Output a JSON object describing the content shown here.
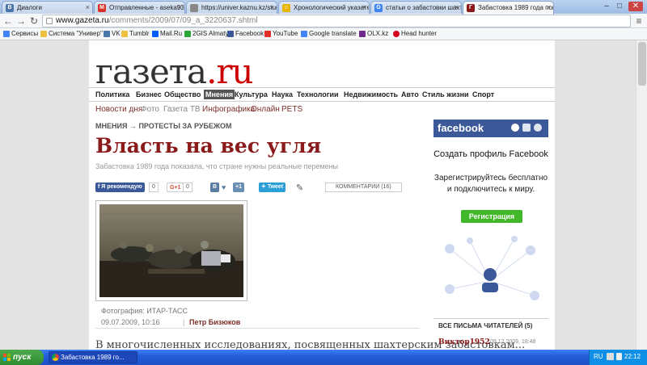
{
  "browser": {
    "tabs": [
      {
        "label": "Диалоги",
        "favicon_color": "#4a76a8",
        "favicon_char": "В"
      },
      {
        "label": "Отправленные - aseka93@...",
        "favicon_color": "#d93025",
        "favicon_char": "M"
      },
      {
        "label": "https://univer.kaznu.kz/stud...",
        "favicon_color": "#888888",
        "favicon_char": ""
      },
      {
        "label": "Хронологический указатель...",
        "favicon_color": "#e8b400",
        "favicon_char": "☺"
      },
      {
        "label": "статьи о забастовки шахтер...",
        "favicon_color": "#4285f4",
        "favicon_char": "G"
      },
      {
        "label": "Забастовка 1989 года пок...",
        "favicon_color": "#8b1a1a",
        "favicon_char": "Г"
      }
    ],
    "active_tab_index": 5,
    "url_domain": "www.gazeta.ru",
    "url_path": "/comments/2009/07/09_a_3220637.shtml",
    "bookmarks": [
      {
        "label": "Сервисы",
        "color": "#4285f4"
      },
      {
        "label": "Система \"Универ\"",
        "color": "#f0c040"
      },
      {
        "label": "VK",
        "color": "#4a76a8"
      },
      {
        "label": "Tumblr",
        "color": "#f0c040"
      },
      {
        "label": "Mail.Ru",
        "color": "#005ff9"
      },
      {
        "label": "2GIS Almaty",
        "color": "#2aa83a"
      },
      {
        "label": "Facebook",
        "color": "#3b5998"
      },
      {
        "label": "YouTube",
        "color": "#e52d27"
      },
      {
        "label": "Google translate",
        "color": "#4285f4"
      },
      {
        "label": "OLX.kz",
        "color": "#6e2b8b"
      },
      {
        "label": "Head hunter",
        "color": "#d6001c"
      }
    ]
  },
  "site": {
    "logo": "газета",
    "logo_tld": ".ru",
    "main_nav": [
      "Политика",
      "Бизнес",
      "Общество",
      "Мнения",
      "Культура",
      "Наука",
      "Технологии",
      "Недвижимость",
      "Авто",
      "Стиль жизни",
      "Спорт"
    ],
    "active_nav": "Мнения",
    "sub_nav": [
      "Новости дня",
      "Фото",
      "Газета ТВ",
      "Инфографика",
      "Онлайн",
      "PETS"
    ]
  },
  "article": {
    "rubric": "МНЕНИЯ → ПРОТЕСТЫ ЗА РУБЕЖОМ",
    "headline": "Власть на вес угля",
    "subtitle": "Забастовка 1989 года показала, что стране нужны реальные перемены",
    "photo_credit": "Фотография: ИТАР-ТАСС",
    "date": "09.07.2009, 10:16",
    "author": "Петр Бизюков",
    "body_start": "В многочисленных исследованиях, посвященных шахтерским забастовкам..."
  },
  "social": {
    "fb_like": "Я рекомендую",
    "fb_count": "0",
    "gplus": "G+1",
    "gplus_count": "0",
    "vk": "В",
    "vk_plus": "+1",
    "twitter": "Tweet",
    "comments": "КОММЕНТАРИИ (16)"
  },
  "sidebar": {
    "fb_brand": "facebook",
    "fb_title": "Создать профиль Facebook",
    "fb_text": "Зарегистрируйтесь бесплатно и подключитесь к миру.",
    "fb_button": "Регистрация",
    "letters_header": "ВСЕ ПИСЬМА ЧИТАТЕЛЕЙ (5)",
    "letter_author": "Виктор1952",
    "letter_date": "09.12.2009, 18:48"
  },
  "taskbar": {
    "start": "пуск",
    "task": "Забастовка 1989 го...",
    "lang": "RU",
    "clock": "22:12"
  },
  "colors": {
    "brand_red": "#8b1a1a",
    "facebook_blue": "#3b5998",
    "xp_blue": "#245edb"
  }
}
